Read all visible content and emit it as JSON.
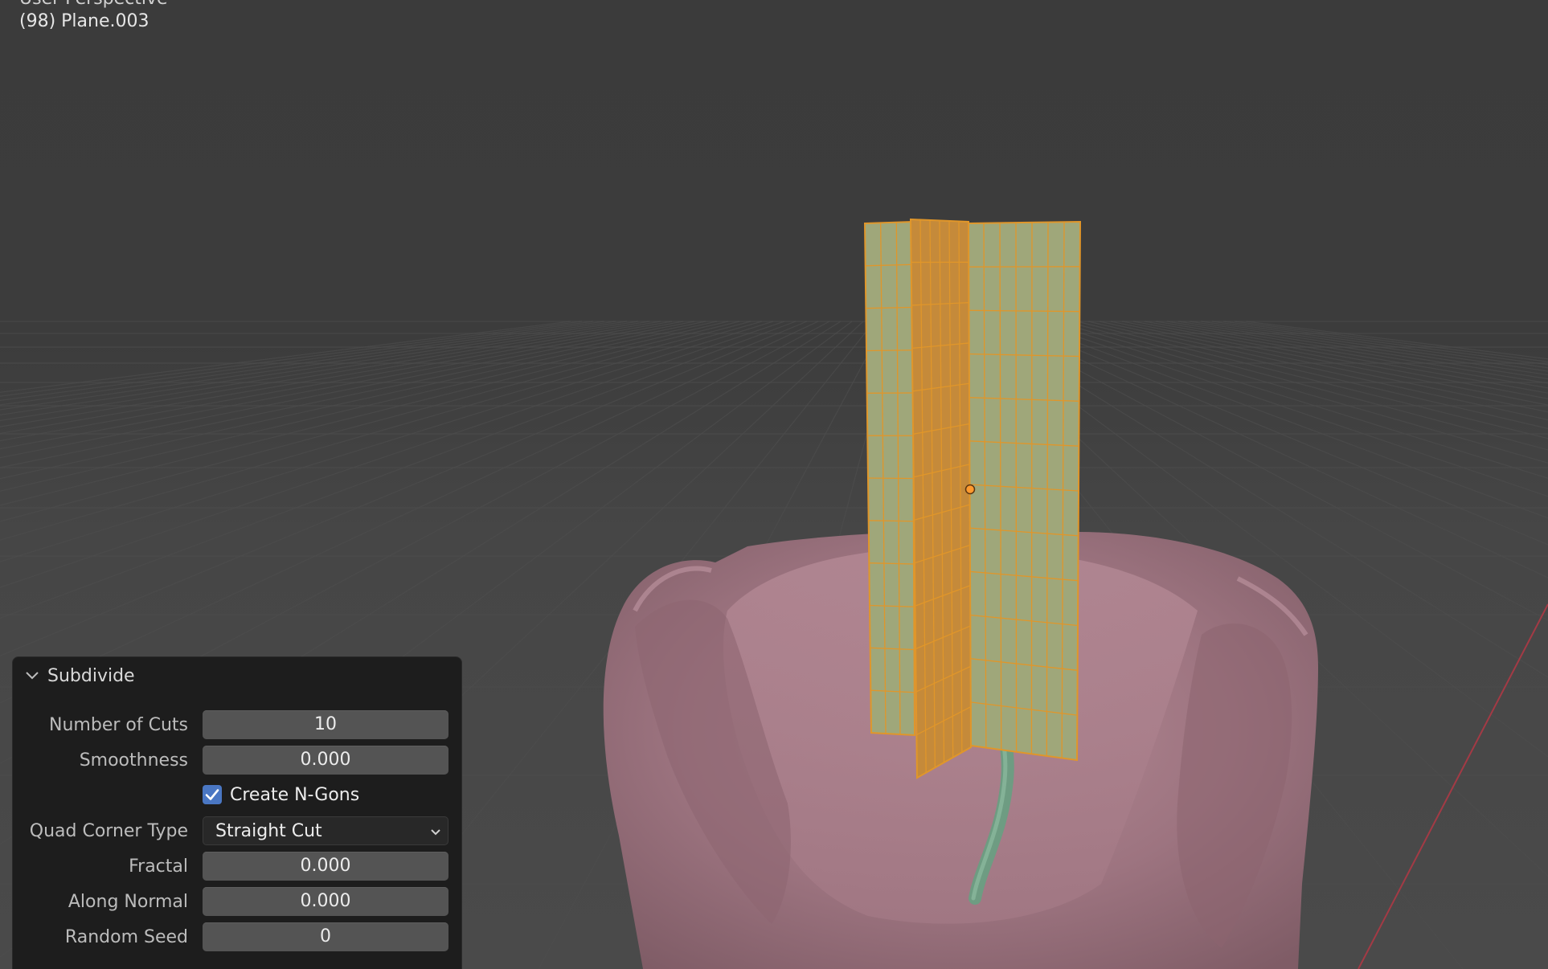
{
  "viewport": {
    "title": "User Perspective",
    "object_label": "(98) Plane.003",
    "colors": {
      "grid_line": "#4d4d4d",
      "x_axis": "#a33a45",
      "mesh_face": "#9fa77a",
      "mesh_dark_face": "#c58a3a",
      "mesh_edge": "#e0962a",
      "origin": "#ff9a2e",
      "body": "#9c7480",
      "curve": "#6e9c82"
    }
  },
  "operator_panel": {
    "title": "Subdivide",
    "chevron_icon": "chevron-down-icon",
    "fields": {
      "number_of_cuts": {
        "label": "Number of Cuts",
        "value": "10"
      },
      "smoothness": {
        "label": "Smoothness",
        "value": "0.000"
      },
      "create_ngons": {
        "label": "Create N-Gons",
        "checked": true
      },
      "quad_corner_type": {
        "label": "Quad Corner Type",
        "value": "Straight Cut"
      },
      "fractal": {
        "label": "Fractal",
        "value": "0.000"
      },
      "along_normal": {
        "label": "Along Normal",
        "value": "0.000"
      },
      "random_seed": {
        "label": "Random Seed",
        "value": "0"
      }
    }
  }
}
